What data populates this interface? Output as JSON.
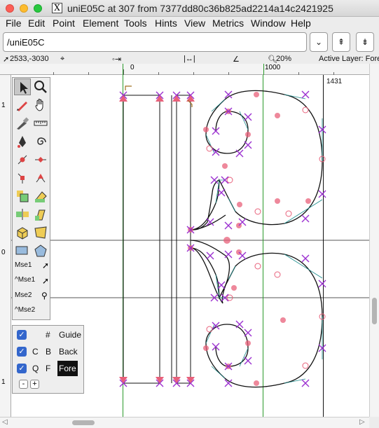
{
  "window": {
    "title": "uniE05C at 307 from 7377dd80c36b825ad2214a14c2421925"
  },
  "menu": [
    "File",
    "Edit",
    "Point",
    "Element",
    "Tools",
    "Hints",
    "View",
    "Metrics",
    "Window",
    "Help"
  ],
  "glyph_name": {
    "value": "/uniE05C"
  },
  "nav_buttons": {
    "dropdown": "⌄",
    "prev": "⇞",
    "next": "⇟"
  },
  "info": {
    "coords": "2533,-3030",
    "zoom": "20%",
    "active_layer": "Active Layer: Fore"
  },
  "ruler": {
    "h_ticks": [
      "0",
      "1000"
    ],
    "v_ticks": [
      "1",
      "0",
      "1"
    ],
    "advance": "1431"
  },
  "tools": {
    "mse1": "Mse1",
    "mse1c": "^Mse1",
    "mse2": "Mse2",
    "mse2c": "^Mse2"
  },
  "layers": [
    {
      "c1": "",
      "c2": "#",
      "name": "Guide",
      "checked": true,
      "active": false
    },
    {
      "c1": "C",
      "c2": "B",
      "name": "Back",
      "checked": true,
      "active": false
    },
    {
      "c1": "Q",
      "c2": "F",
      "name": "Fore",
      "checked": true,
      "active": true
    }
  ],
  "layer_buttons": {
    "remove": "-",
    "add": "+"
  },
  "colors": {
    "outline": "#111111",
    "control_point": "#9b30d0",
    "on_curve": "#e8607a",
    "guide": "#444444"
  }
}
